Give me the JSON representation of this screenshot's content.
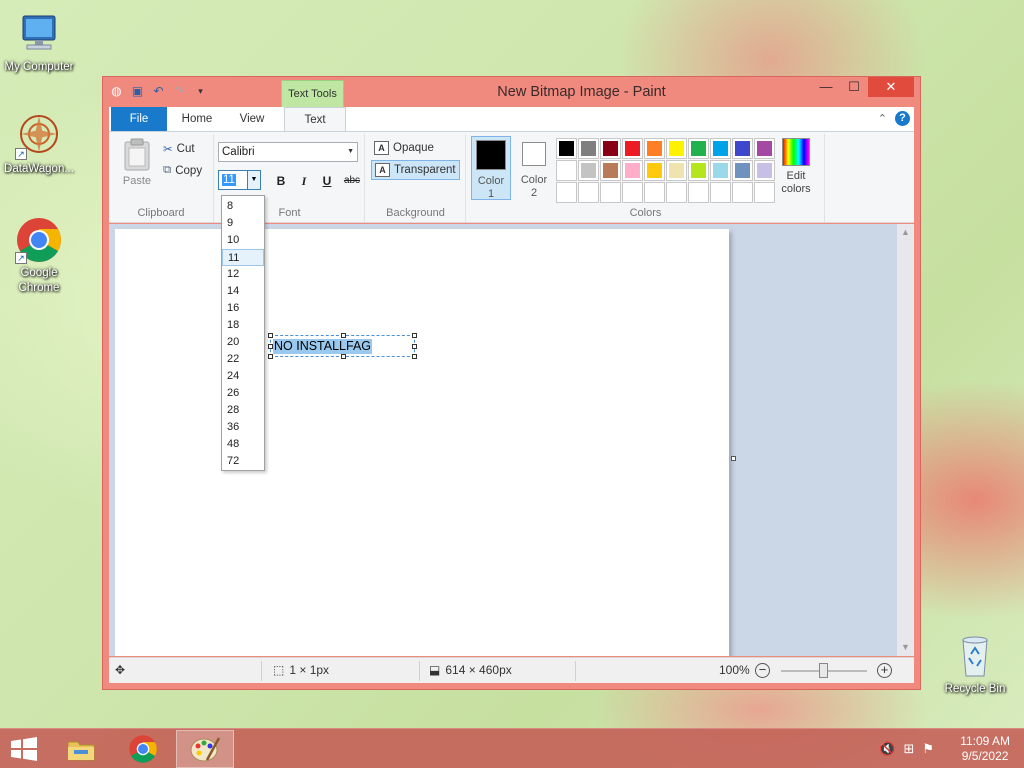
{
  "desktop": {
    "icons": [
      {
        "label": "My Computer",
        "icon": "computer-icon"
      },
      {
        "label": "DataWagon...",
        "icon": "datawagon-icon"
      },
      {
        "label": "Google Chrome",
        "icon": "chrome-icon"
      },
      {
        "label": "Recycle Bin",
        "icon": "recycle-bin-icon"
      }
    ]
  },
  "window": {
    "title": "New Bitmap Image - Paint",
    "contextual_tab": "Text Tools",
    "controls": {
      "minimize": "—",
      "maximize": "☐",
      "close": "✕"
    }
  },
  "tabs": [
    {
      "label": "File"
    },
    {
      "label": "Home"
    },
    {
      "label": "View"
    },
    {
      "label": "Text",
      "active": true
    }
  ],
  "ribbon": {
    "clipboard": {
      "paste": "Paste",
      "cut": "Cut",
      "copy": "Copy",
      "group": "Clipboard"
    },
    "font": {
      "family": "Calibri",
      "size": "11",
      "bold": "B",
      "italic": "I",
      "underline": "U",
      "strikethrough": "abc",
      "group": "Font"
    },
    "background": {
      "opaque": "Opaque",
      "transparent": "Transparent",
      "selected": "Transparent",
      "group": "Background"
    },
    "colors": {
      "color1_label": "Color",
      "color1_num": "1",
      "color2_label": "Color",
      "color2_num": "2",
      "color1_value": "#000000",
      "color2_value": "#ffffff",
      "edit_line1": "Edit",
      "edit_line2": "colors",
      "group": "Colors",
      "palette": [
        "#000000",
        "#7f7f7f",
        "#880015",
        "#ed1c24",
        "#ff7f27",
        "#fff200",
        "#22b14c",
        "#00a2e8",
        "#3f48cc",
        "#a349a4",
        "#ffffff",
        "#c3c3c3",
        "#b97a57",
        "#ffaec9",
        "#ffc90e",
        "#efe4b0",
        "#b5e61d",
        "#99d9ea",
        "#7092be",
        "#c8bfe7",
        "",
        "",
        "",
        "",
        "",
        "",
        "",
        "",
        "",
        ""
      ]
    }
  },
  "font_size_dropdown": {
    "options": [
      "8",
      "9",
      "10",
      "11",
      "12",
      "14",
      "16",
      "18",
      "20",
      "22",
      "24",
      "26",
      "28",
      "36",
      "48",
      "72"
    ],
    "highlighted": "11"
  },
  "canvas": {
    "text": "NO INSTALLFAG"
  },
  "status": {
    "selection_size": "1 × 1px",
    "canvas_size": "614 × 460px",
    "zoom": "100%",
    "zoom_out": "−",
    "zoom_in": "+"
  },
  "taskbar": {
    "apps": [
      "file-explorer-icon",
      "chrome-icon",
      "paint-icon"
    ],
    "active_app": "paint-icon",
    "time": "11:09 AM",
    "date": "9/5/2022"
  }
}
